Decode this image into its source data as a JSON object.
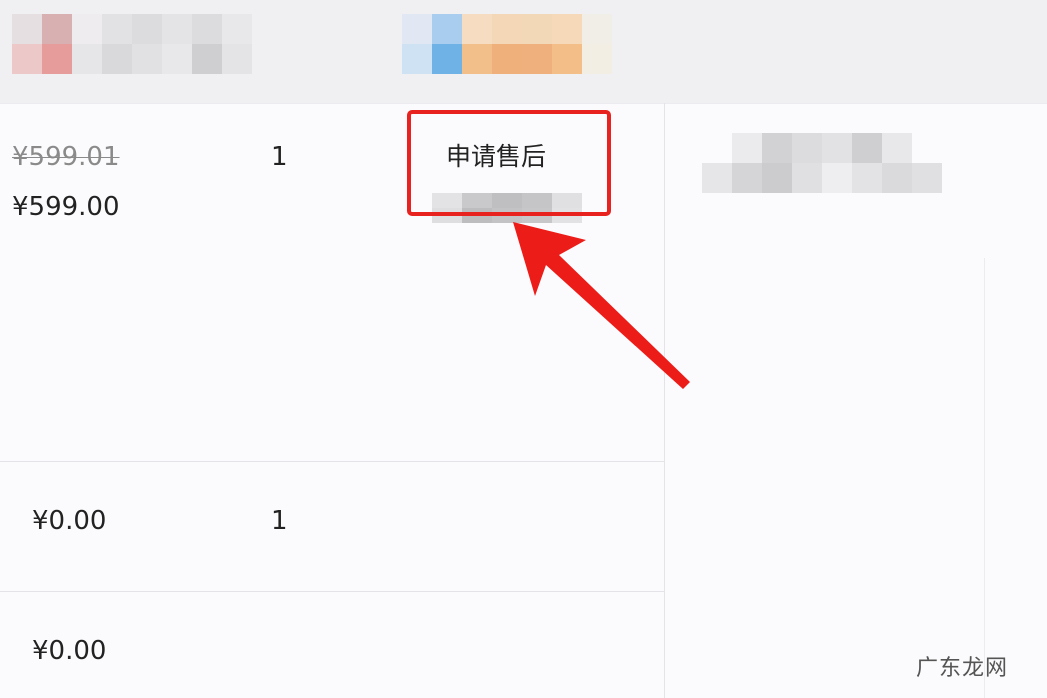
{
  "items": [
    {
      "original_price": "¥599.01",
      "price": "¥599.00",
      "quantity": "1",
      "action_label": "申请售后"
    },
    {
      "price": "¥0.00",
      "quantity": "1"
    },
    {
      "price": "¥0.00"
    }
  ],
  "watermark": "广东龙网",
  "colors": {
    "annotation": "#e8221f",
    "background": "#fbfafc",
    "header": "#f0eff1"
  },
  "blurred_regions": [
    "header-left-blur",
    "header-center-blur",
    "action-subtext-blur",
    "right-column-blur"
  ]
}
